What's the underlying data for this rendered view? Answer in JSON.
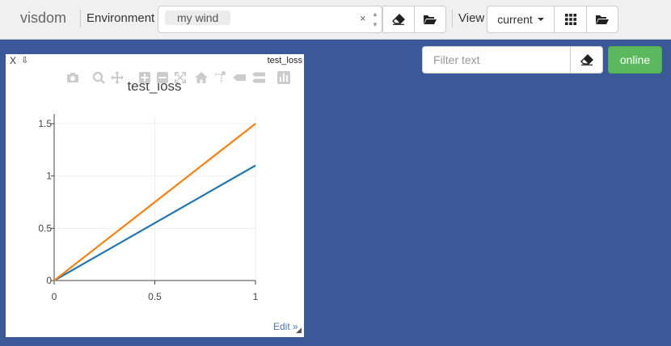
{
  "navbar": {
    "brand": "visdom",
    "environment_label": "Environment",
    "environment_chip": "my wind",
    "clear_symbol": "×",
    "view_label": "View",
    "view_selected": "current"
  },
  "filter": {
    "placeholder": "Filter text",
    "status_label": "online",
    "status_color": "#5cb85c"
  },
  "pane": {
    "close_label": "X",
    "download_symbol": "⇩",
    "window_title": "test_loss",
    "edit_label": "Edit »",
    "modebar_icons": [
      "camera-icon",
      "zoom-icon",
      "pan-icon",
      "zoom-in-icon",
      "zoom-out-icon",
      "autoscale-icon",
      "home-icon",
      "spike-lines-icon",
      "hover-closest-icon",
      "hover-compare-icon",
      "plotly-logo-icon"
    ]
  },
  "chart_data": {
    "type": "line",
    "title": "test_loss",
    "xlabel": "",
    "ylabel": "",
    "xlim": [
      0,
      1
    ],
    "ylim": [
      0,
      1.5
    ],
    "x_ticks": [
      "0",
      "0.5",
      "1"
    ],
    "y_ticks": [
      "0",
      "0.5",
      "1",
      "1.5"
    ],
    "grid": true,
    "legend": "none",
    "series": [
      {
        "color": "#1f77b4",
        "x": [
          0,
          1
        ],
        "y": [
          0,
          1.1
        ]
      },
      {
        "color": "#ff7f0e",
        "x": [
          0,
          1
        ],
        "y": [
          0,
          1.5
        ]
      }
    ]
  }
}
